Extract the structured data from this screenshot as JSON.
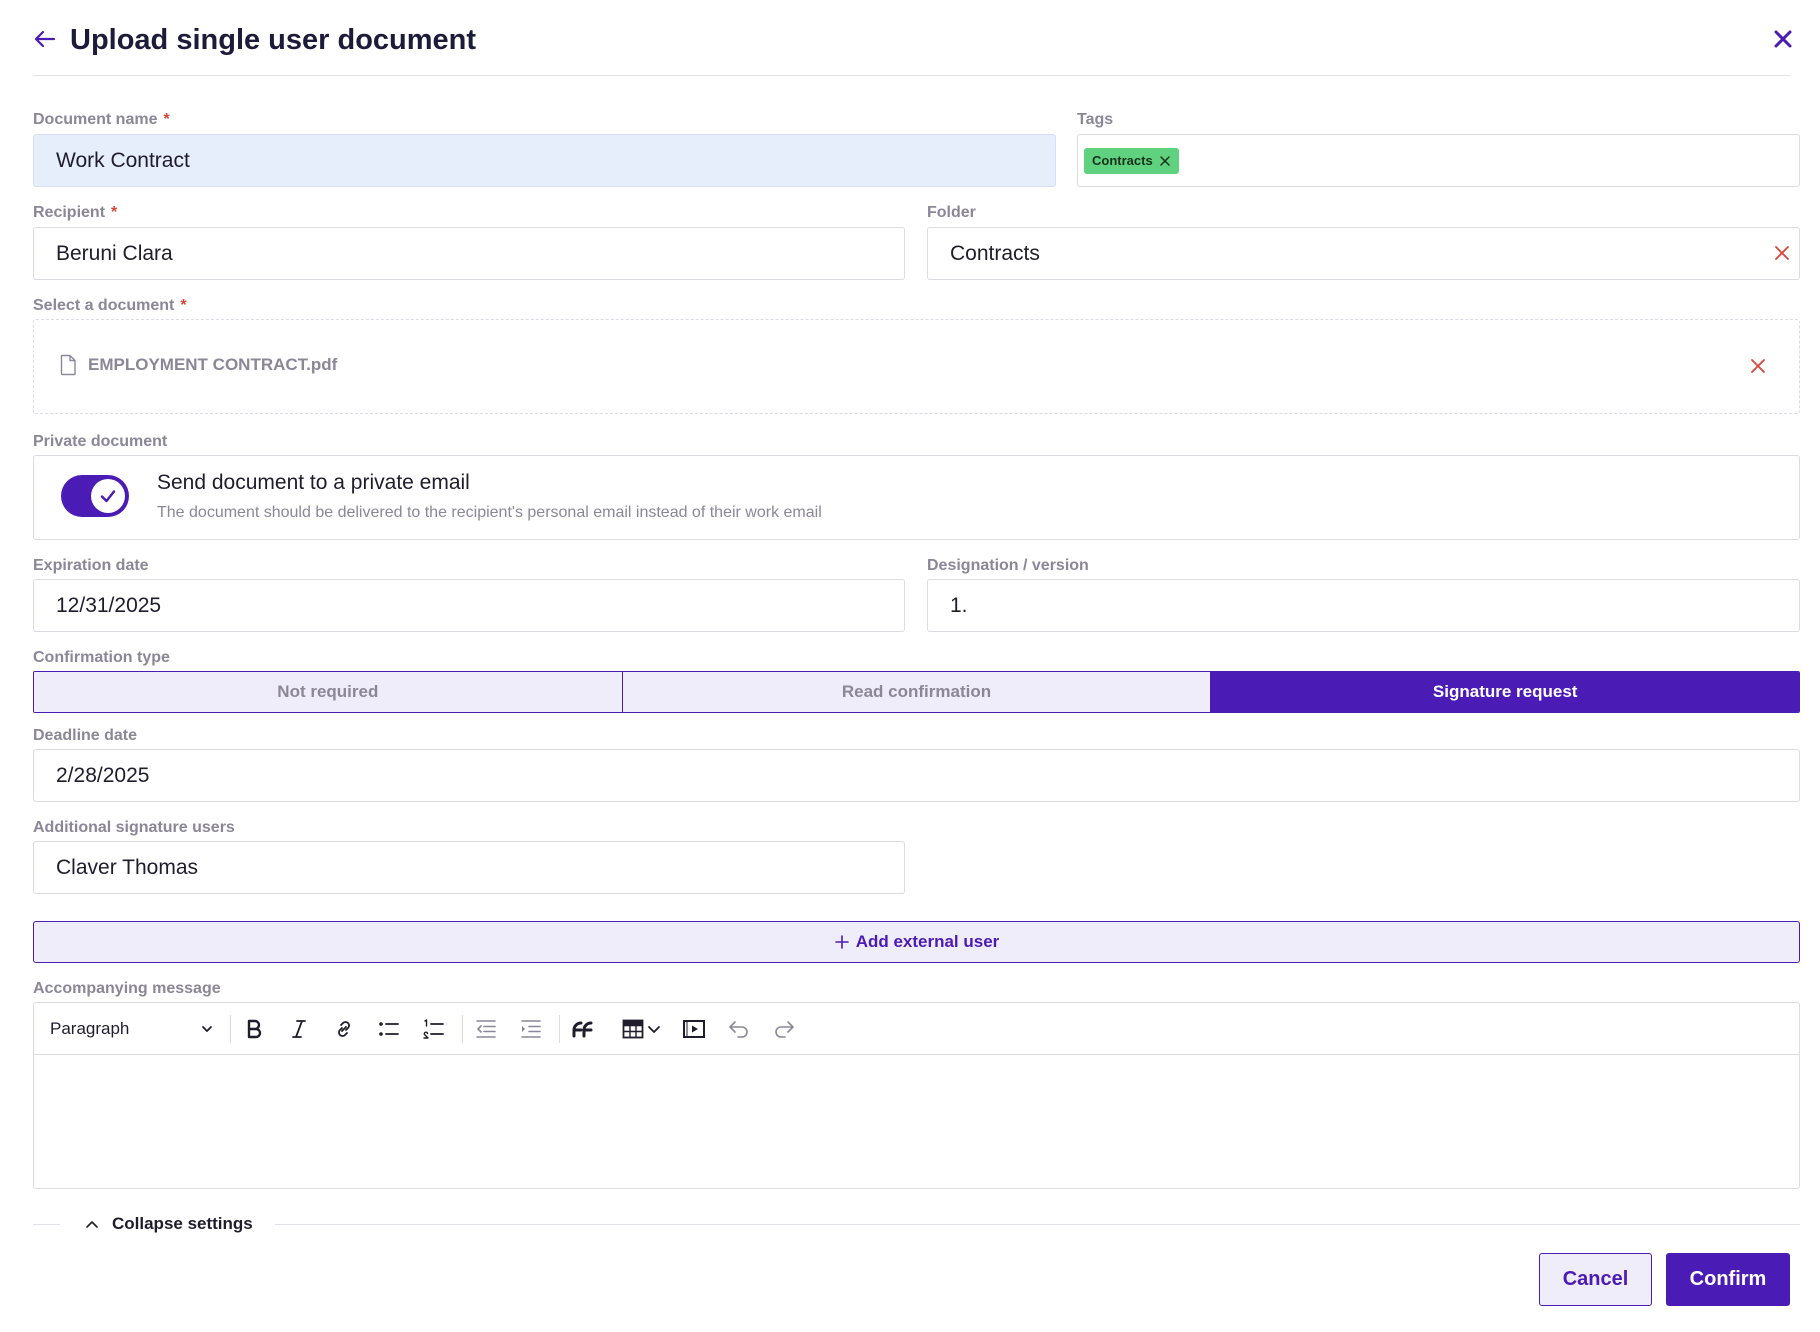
{
  "header": {
    "title": "Upload single user document",
    "back_icon": "arrow-left-icon",
    "close_icon": "close-icon"
  },
  "colors": {
    "accent": "#4b1bb6",
    "required": "#d9453b",
    "tag_green": "#5fd17f",
    "filled_input": "#e6edfb"
  },
  "document_name": {
    "label": "Document name",
    "value": "Work Contract",
    "required": "*"
  },
  "tags": {
    "label": "Tags",
    "items": [
      {
        "label": "Contracts"
      }
    ]
  },
  "recipient": {
    "label": "Recipient",
    "value": "Beruni Clara",
    "required": "*"
  },
  "folder": {
    "label": "Folder",
    "value": "Contracts"
  },
  "select_document": {
    "label": "Select a document",
    "required": "*",
    "file_name": "EMPLOYMENT CONTRACT.pdf"
  },
  "private_document": {
    "label": "Private document",
    "toggle_on": true,
    "title": "Send document to a private email",
    "description": "The document should be delivered to the recipient's personal email instead of their work email"
  },
  "expiration_date": {
    "label": "Expiration date",
    "value": "12/31/2025"
  },
  "designation": {
    "label": "Designation / version",
    "value": "1."
  },
  "confirmation_type": {
    "label": "Confirmation type",
    "options": [
      "Not required",
      "Read confirmation",
      "Signature request"
    ],
    "selected": "Signature request"
  },
  "deadline_date": {
    "label": "Deadline date",
    "value": "2/28/2025"
  },
  "additional_signature_users": {
    "label": "Additional signature users",
    "value": "Claver Thomas"
  },
  "add_external_user": {
    "label": "Add external user"
  },
  "accompanying_message": {
    "label": "Accompanying message",
    "paragraph_select": "Paragraph",
    "toolbar_icons": [
      "bold-icon",
      "italic-icon",
      "link-icon",
      "bulleted-list-icon",
      "numbered-list-icon",
      "outdent-icon",
      "indent-icon",
      "blockquote-icon",
      "table-icon",
      "media-embed-icon",
      "undo-icon",
      "redo-icon"
    ],
    "value": ""
  },
  "collapse_settings": {
    "label": "Collapse settings"
  },
  "footer": {
    "cancel_label": "Cancel",
    "confirm_label": "Confirm"
  }
}
